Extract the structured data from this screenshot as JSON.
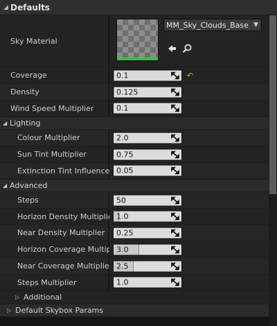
{
  "header": {
    "title": "Defaults"
  },
  "sky_material": {
    "label": "Sky Material",
    "asset_name": "MM_Sky_Clouds_Base",
    "browse_icon": "arrow-left-icon",
    "find_icon": "search-icon"
  },
  "top_props": [
    {
      "label": "Coverage",
      "value": "0.1",
      "fill": 0.01,
      "reset_icon": "reset-arrow-icon"
    },
    {
      "label": "Density",
      "value": "0.125",
      "fill": 0.01
    },
    {
      "label": "Wind Speed Multiplier",
      "value": "0.1",
      "fill": 0
    }
  ],
  "lighting": {
    "title": "Lighting",
    "props": [
      {
        "label": "Colour Multiplier",
        "value": "2.0"
      },
      {
        "label": "Sun Tint Multiplier",
        "value": "0.75"
      },
      {
        "label": "Extinction Tint Influence",
        "value": "0.05"
      }
    ]
  },
  "advanced": {
    "title": "Advanced",
    "props": [
      {
        "label": "Steps",
        "value": "50",
        "fill": 0
      },
      {
        "label": "Horizon Density Multiplier",
        "value": "1.0",
        "fill": 0.08
      },
      {
        "label": "Near Density Multiplier",
        "value": "0.25",
        "fill": 0
      },
      {
        "label": "Horizon Coverage Multiplie",
        "value": "3.0",
        "fill": 0.38
      },
      {
        "label": "Near Coverage Multiplier",
        "value": "2.5",
        "fill": 0.3
      },
      {
        "label": "Steps Multiplier",
        "value": "1.0",
        "fill": 0
      }
    ]
  },
  "additional": {
    "title": "Additional"
  },
  "default_skybox": {
    "title": "Default Skybox Params"
  },
  "colors": {
    "background": "#151515",
    "header_bg": "#2f2f2f",
    "row_bg": "#232323",
    "field_bg": "#dcdcdc",
    "reset_accent": "#d9b300",
    "thumb_bar": "#3bc23b"
  }
}
